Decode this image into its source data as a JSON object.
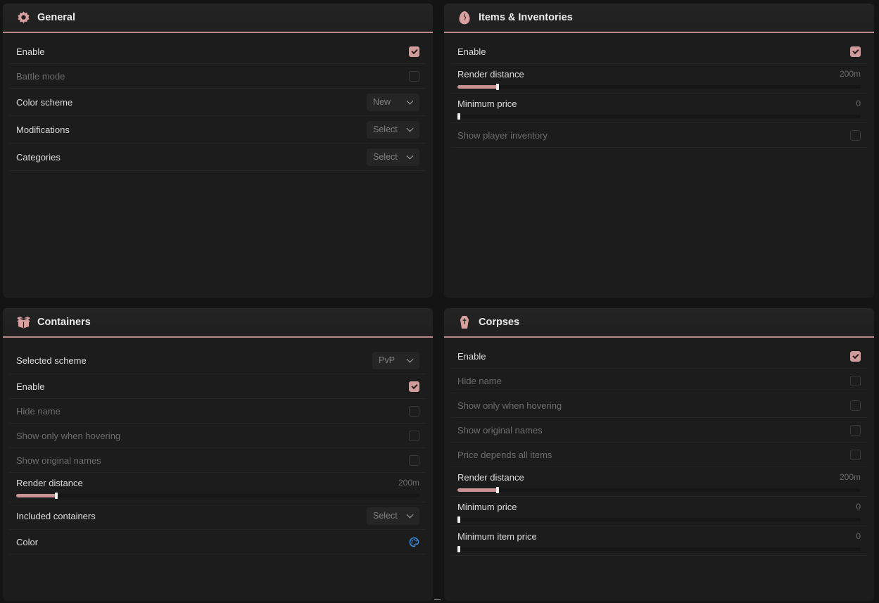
{
  "theme": {
    "accent": "#cf9b9b",
    "bg": "#141414",
    "panel": "#1c1c1c"
  },
  "general": {
    "title": "General",
    "icon": "gear-icon",
    "enable_label": "Enable",
    "enable_checked": true,
    "battle_mode_label": "Battle mode",
    "battle_mode_checked": false,
    "color_scheme_label": "Color scheme",
    "color_scheme_value": "New",
    "modifications_label": "Modifications",
    "modifications_value": "Select",
    "categories_label": "Categories",
    "categories_value": "Select"
  },
  "items": {
    "title": "Items & Inventories",
    "icon": "egg-icon",
    "enable_label": "Enable",
    "enable_checked": true,
    "render_distance_label": "Render distance",
    "render_distance_value": "200m",
    "render_distance_level": 0.1,
    "minimum_price_label": "Minimum price",
    "minimum_price_value": "0",
    "minimum_price_level": 0,
    "show_player_inventory_label": "Show player inventory",
    "show_player_inventory_checked": false
  },
  "containers": {
    "title": "Containers",
    "icon": "box-icon",
    "selected_scheme_label": "Selected scheme",
    "selected_scheme_value": "PvP",
    "enable_label": "Enable",
    "enable_checked": true,
    "hide_name_label": "Hide name",
    "show_only_hovering_label": "Show only when hovering",
    "show_original_names_label": "Show original names",
    "render_distance_label": "Render distance",
    "render_distance_value": "200m",
    "render_distance_level": 0.1,
    "included_containers_label": "Included containers",
    "included_containers_value": "Select",
    "color_label": "Color",
    "color_icon": "palette-icon"
  },
  "corpses": {
    "title": "Corpses",
    "icon": "coffin-icon",
    "enable_label": "Enable",
    "enable_checked": true,
    "hide_name_label": "Hide name",
    "show_only_hovering_label": "Show only when hovering",
    "show_original_names_label": "Show original names",
    "price_depends_label": "Price depends all items",
    "render_distance_label": "Render distance",
    "render_distance_value": "200m",
    "render_distance_level": 0.1,
    "minimum_price_label": "Minimum price",
    "minimum_price_value": "0",
    "minimum_price_level": 0,
    "minimum_item_price_label": "Minimum item price",
    "minimum_item_price_value": "0",
    "minimum_item_price_level": 0
  }
}
